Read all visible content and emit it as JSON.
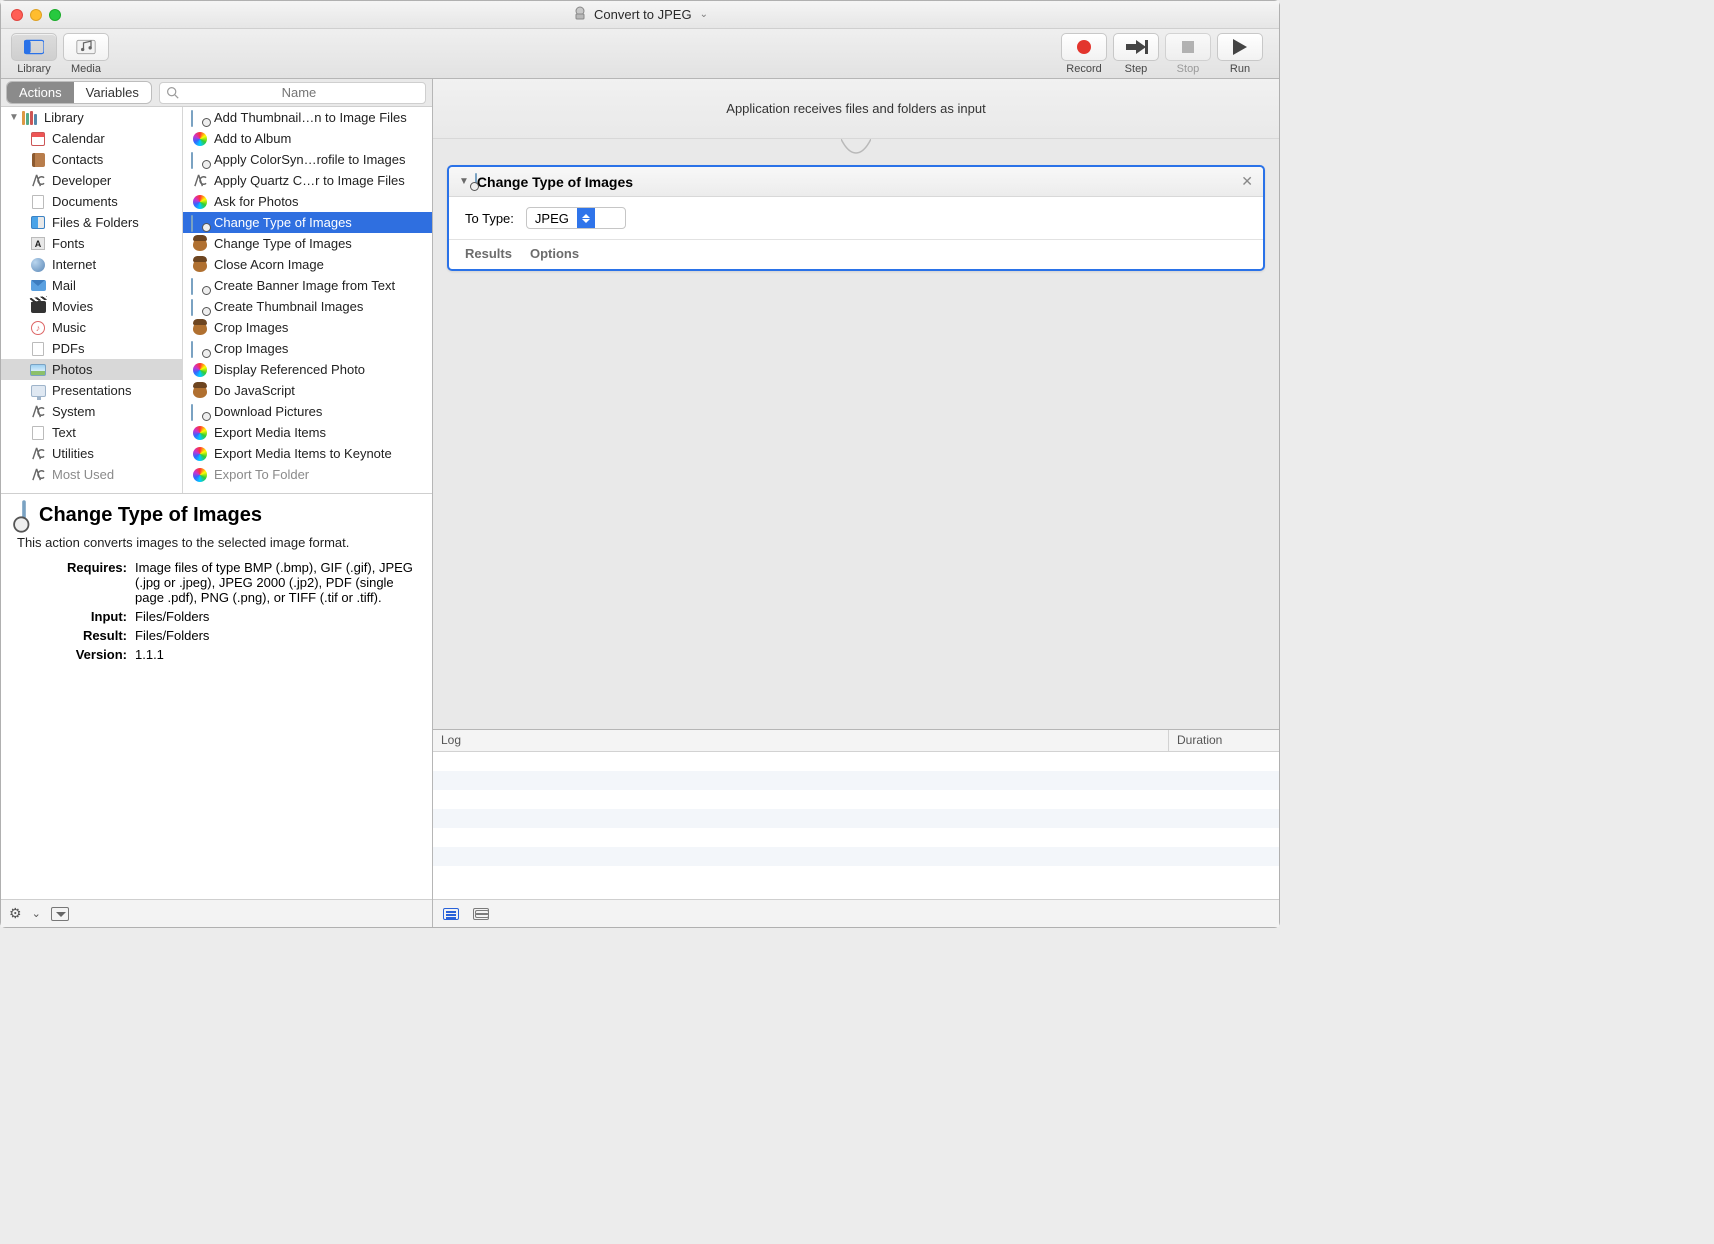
{
  "window": {
    "title": "Convert to JPEG"
  },
  "toolbar": {
    "library": "Library",
    "media": "Media",
    "record": "Record",
    "step": "Step",
    "stop": "Stop",
    "run": "Run"
  },
  "librow": {
    "actions": "Actions",
    "variables": "Variables",
    "search_placeholder": "Name"
  },
  "categories": {
    "top": "Library",
    "items": [
      "Calendar",
      "Contacts",
      "Developer",
      "Documents",
      "Files & Folders",
      "Fonts",
      "Internet",
      "Mail",
      "Movies",
      "Music",
      "PDFs",
      "Photos",
      "Presentations",
      "System",
      "Text",
      "Utilities",
      "Most Used"
    ],
    "selected_index": 11
  },
  "actions": {
    "items": [
      "Add Thumbnail…n to Image Files",
      "Add to Album",
      "Apply ColorSyn…rofile to Images",
      "Apply Quartz C…r to Image Files",
      "Ask for Photos",
      "Change Type of Images",
      "Change Type of Images",
      "Close Acorn Image",
      "Create Banner Image from Text",
      "Create Thumbnail Images",
      "Crop Images",
      "Crop Images",
      "Display Referenced Photo",
      "Do JavaScript",
      "Download Pictures",
      "Export Media Items",
      "Export Media Items to Keynote",
      "Export To Folder"
    ],
    "selected_index": 5,
    "icon_kind": [
      "photoaction",
      "colors",
      "photoaction",
      "wrench",
      "colors",
      "photoaction",
      "acorn",
      "acorn",
      "photoaction",
      "photoaction",
      "acorn",
      "photoaction",
      "colors",
      "acorn",
      "photoaction",
      "colors",
      "colors",
      "colors"
    ]
  },
  "info": {
    "title": "Change Type of Images",
    "desc": "This action converts images to the selected image format.",
    "rows": {
      "Requires": "Image files of type BMP (.bmp), GIF (.gif), JPEG (.jpg or .jpeg), JPEG 2000 (.jp2), PDF (single page .pdf), PNG (.png), or TIFF (.tif or .tiff).",
      "Input": "Files/Folders",
      "Result": "Files/Folders",
      "Version": "1.1.1"
    }
  },
  "workflow": {
    "input_text": "Application receives files and folders as input",
    "step1": {
      "title": "Change Type of Images",
      "field_label": "To Type:",
      "field_value": "JPEG",
      "results": "Results",
      "options": "Options"
    }
  },
  "log": {
    "col_log": "Log",
    "col_duration": "Duration"
  }
}
